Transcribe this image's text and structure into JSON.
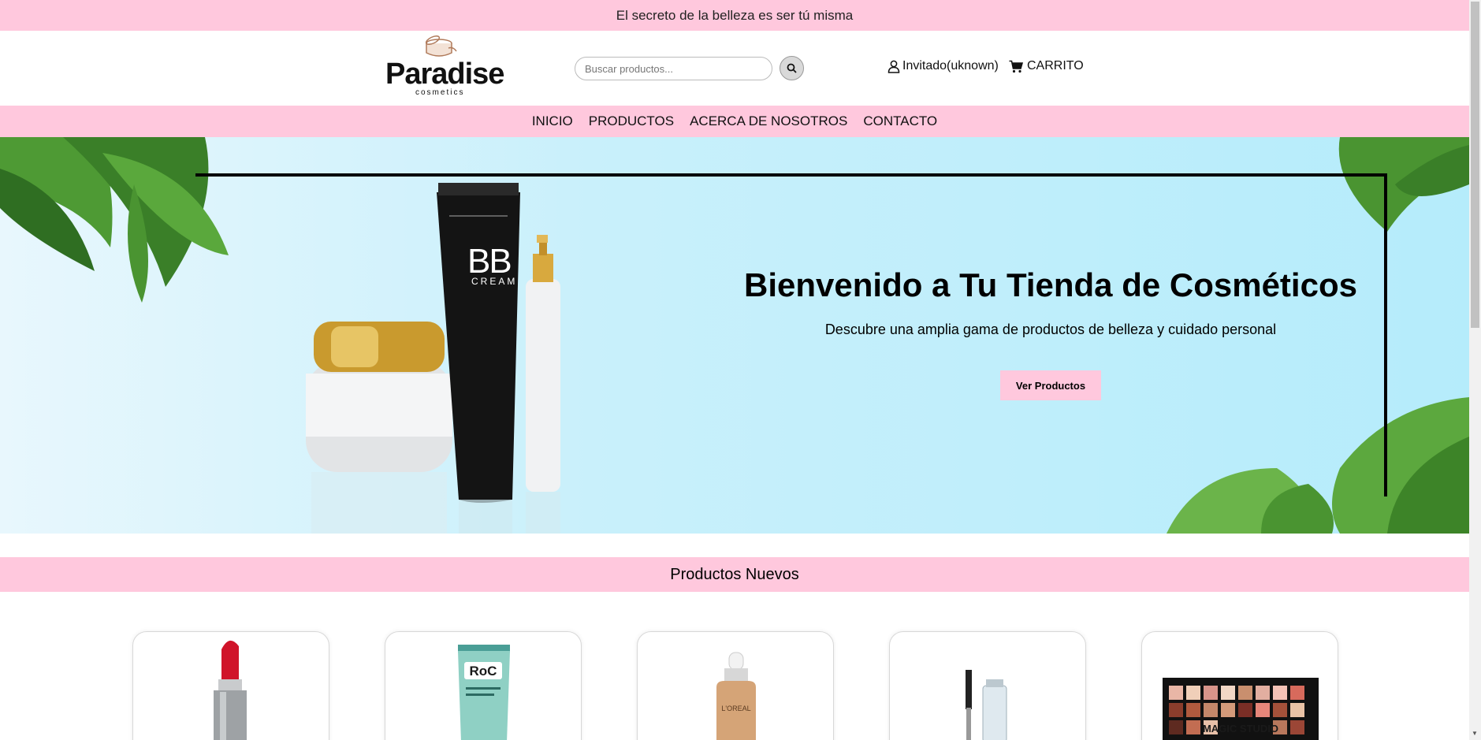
{
  "announcement": "El secreto de la belleza es ser tú misma",
  "logo": {
    "word": "Paradise",
    "subtitle": "cosmetics"
  },
  "search": {
    "placeholder": "Buscar productos..."
  },
  "account": {
    "label": "Invitado(uknown)"
  },
  "cart": {
    "label": "CARRITO"
  },
  "nav": {
    "items": [
      "INICIO",
      "PRODUCTOS",
      "ACERCA DE NOSOTROS",
      "CONTACTO"
    ]
  },
  "hero": {
    "title": "Bienvenido a Tu Tienda de Cosméticos",
    "subtitle": "Descubre una amplia gama de productos de belleza y cuidado personal",
    "button": "Ver Productos",
    "tube_text_1": "BB",
    "tube_text_2": "CREAM"
  },
  "section": {
    "title": "Productos Nuevos"
  },
  "products": [
    {
      "image": "lipstick"
    },
    {
      "image": "roc-cream-tube",
      "brand": "RoC"
    },
    {
      "image": "serum-bottle",
      "brand": "L'OREAL"
    },
    {
      "image": "mascara"
    },
    {
      "image": "eyeshadow-palette",
      "brand": "MAGIC STUDIO"
    }
  ],
  "colors": {
    "pink": "#ffc8dd",
    "hero_blue": "#b5ecfb"
  }
}
